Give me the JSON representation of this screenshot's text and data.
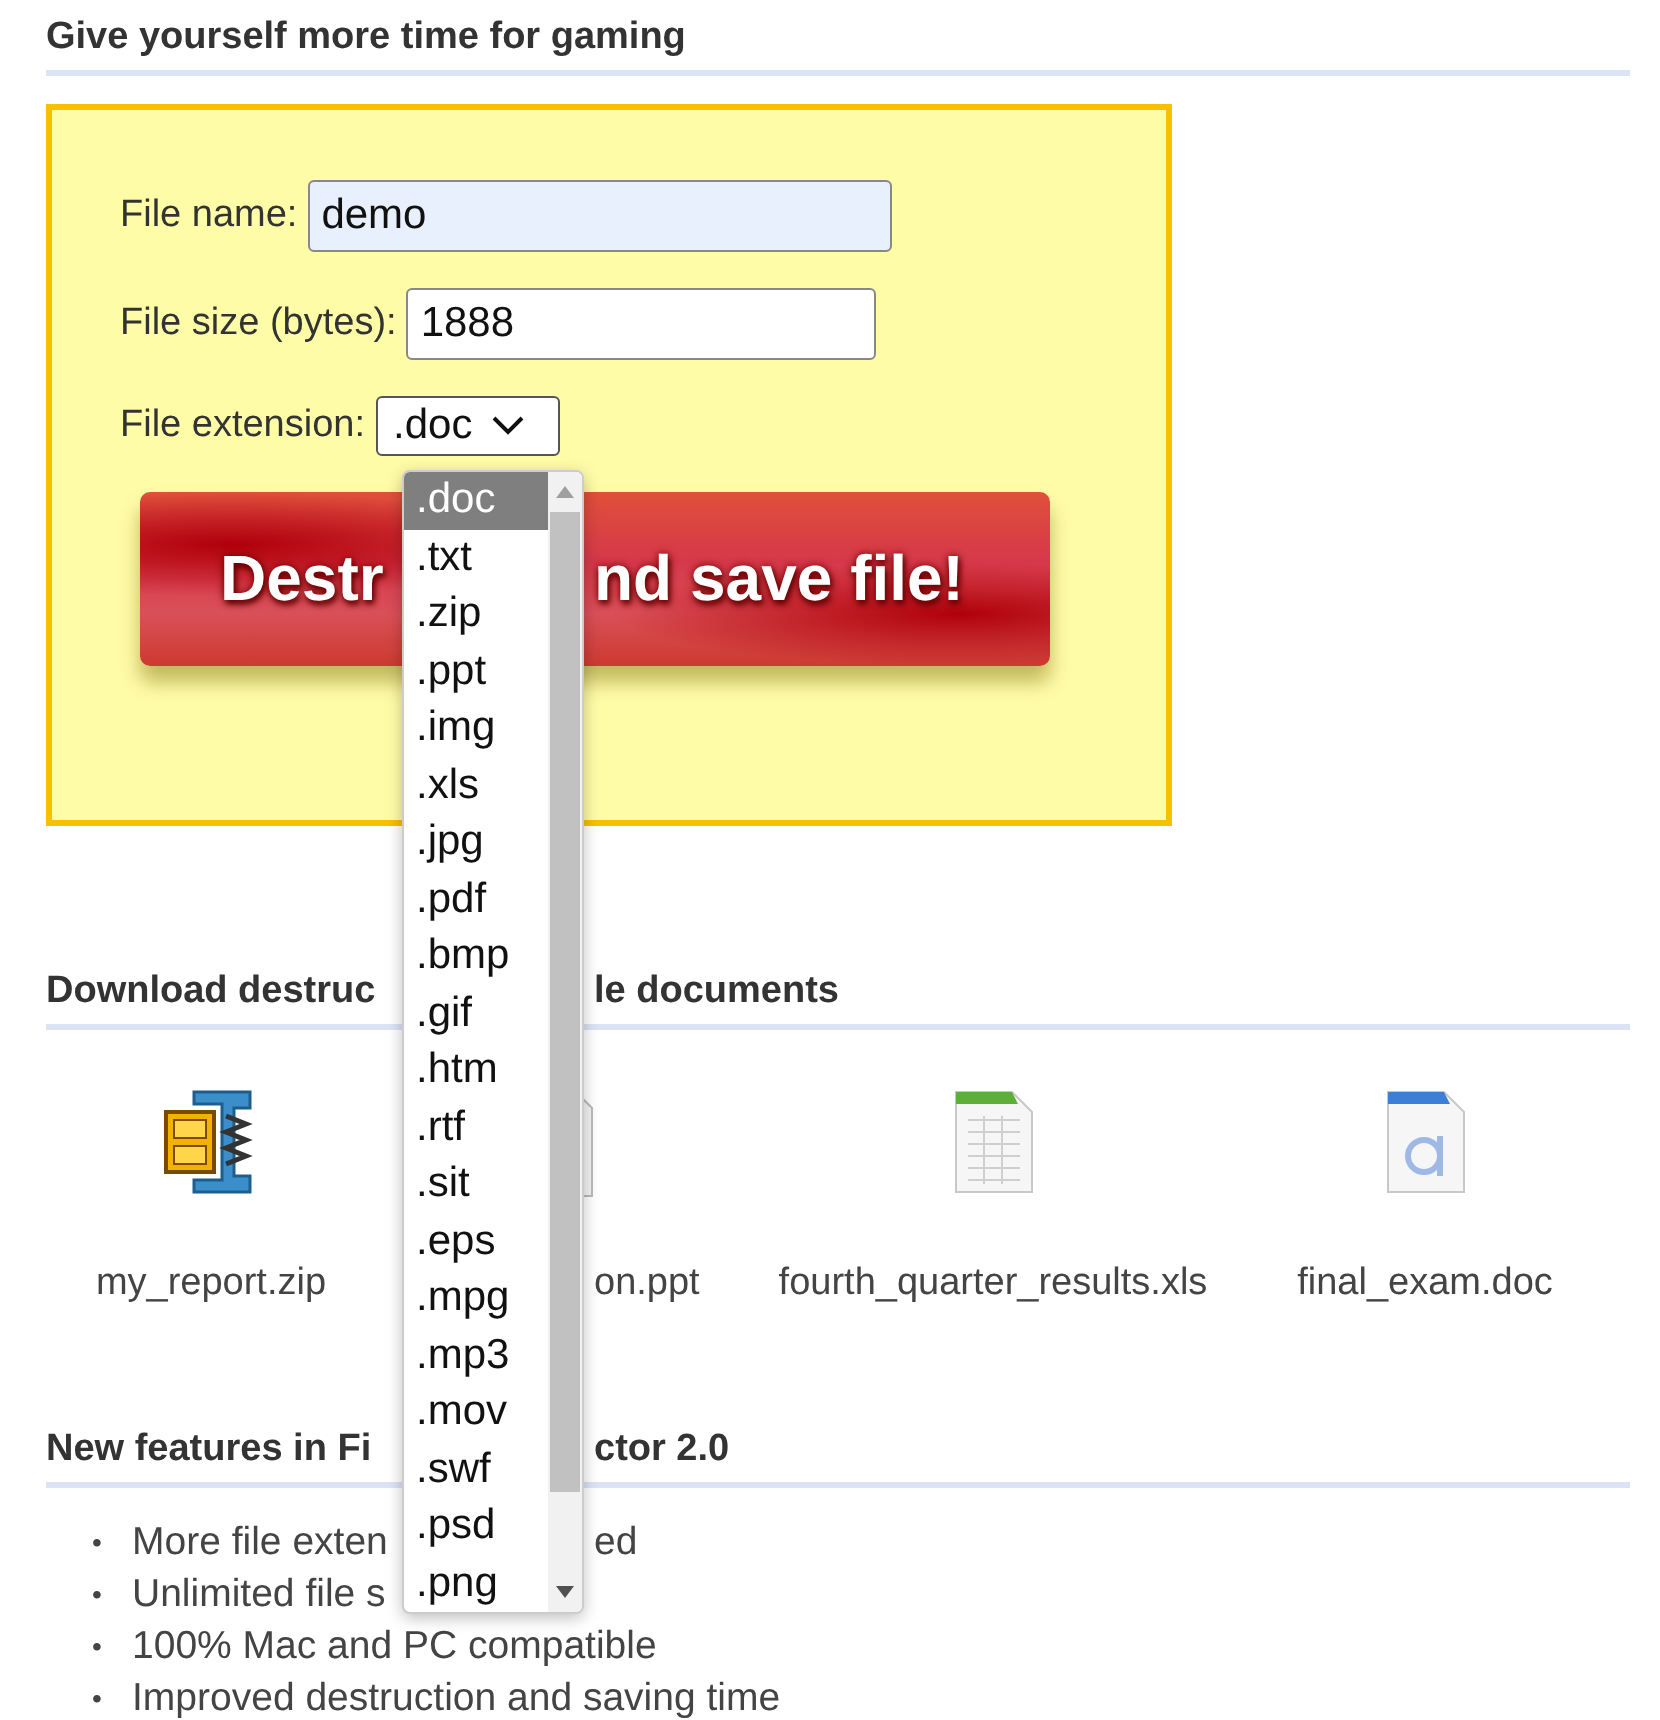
{
  "header": {
    "title": "Give yourself more time for gaming"
  },
  "form": {
    "fields": [
      {
        "kind": "text",
        "label": "File name:",
        "value": "demo",
        "autofilled": true
      },
      {
        "kind": "text",
        "label": "File size (bytes):",
        "value": "1888",
        "autofilled": false
      },
      {
        "kind": "select",
        "label": "File extension:",
        "value": ".doc"
      }
    ],
    "button": {
      "text_parts": [
        "Destr",
        "nd save file!"
      ]
    }
  },
  "dropdown": {
    "options": [
      {
        "label": ".doc",
        "selected": true
      },
      {
        "label": ".txt",
        "selected": false
      },
      {
        "label": ".zip",
        "selected": false
      },
      {
        "label": ".ppt",
        "selected": false
      },
      {
        "label": ".img",
        "selected": false
      },
      {
        "label": ".xls",
        "selected": false
      },
      {
        "label": ".jpg",
        "selected": false
      },
      {
        "label": ".pdf",
        "selected": false
      },
      {
        "label": ".bmp",
        "selected": false
      },
      {
        "label": ".gif",
        "selected": false
      },
      {
        "label": ".htm",
        "selected": false
      },
      {
        "label": ".rtf",
        "selected": false
      },
      {
        "label": ".sit",
        "selected": false
      },
      {
        "label": ".eps",
        "selected": false
      },
      {
        "label": ".mpg",
        "selected": false
      },
      {
        "label": ".mp3",
        "selected": false
      },
      {
        "label": ".mov",
        "selected": false
      },
      {
        "label": ".swf",
        "selected": false
      },
      {
        "label": ".psd",
        "selected": false
      },
      {
        "label": ".png",
        "selected": false
      }
    ]
  },
  "downloads": {
    "heading_parts": [
      "Download destruc",
      "le documents"
    ],
    "files": [
      {
        "kind": "zip",
        "name": "my_report.zip"
      },
      {
        "kind": "ppt",
        "name": "on.ppt"
      },
      {
        "kind": "xls",
        "name": "fourth_quarter_results.xls"
      },
      {
        "kind": "doc",
        "name": "final_exam.doc"
      }
    ]
  },
  "features": {
    "heading_parts": [
      "New features in Fi",
      "ctor 2.0"
    ],
    "items": [
      {
        "bullet": "•",
        "parts": [
          "More file exten",
          "ed"
        ]
      },
      {
        "bullet": "•",
        "parts": [
          "Unlimited file s"
        ]
      },
      {
        "bullet": "•",
        "parts": [
          "100% Mac and PC compatible"
        ]
      },
      {
        "bullet": "•",
        "parts": [
          "Improved destruction and saving time"
        ]
      }
    ]
  }
}
